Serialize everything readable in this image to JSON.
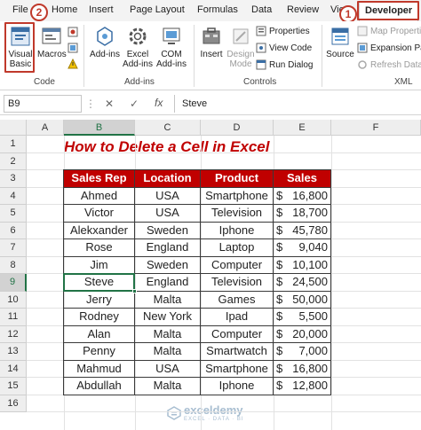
{
  "ribbon": {
    "tabs": [
      "File",
      "Home",
      "Insert",
      "Page Layout",
      "Formulas",
      "Data",
      "Review",
      "View",
      "Developer"
    ],
    "active_tab": "Developer",
    "groups": {
      "code": {
        "label": "Code",
        "visual_basic": "Visual Basic",
        "macros": "Macros"
      },
      "addins": {
        "label": "Add-ins",
        "add_ins": "Add-ins",
        "excel_add_ins": "Excel Add-ins",
        "com_add_ins": "COM Add-ins"
      },
      "controls": {
        "label": "Controls",
        "insert": "Insert",
        "design_mode": "Design Mode",
        "properties": "Properties",
        "view_code": "View Code",
        "run_dialog": "Run Dialog"
      },
      "xml": {
        "label": "XML",
        "source": "Source",
        "map_properties": "Map Properties",
        "expansion_packs": "Expansion Pac",
        "refresh_data": "Refresh Data"
      }
    },
    "badges": {
      "developer": "1",
      "visual_basic": "2"
    }
  },
  "formula_bar": {
    "name_box": "B9",
    "cancel_symbol": "✕",
    "enter_symbol": "✓",
    "fx_label": "fx",
    "value": "Steve"
  },
  "sheet": {
    "columns": [
      "A",
      "B",
      "C",
      "D",
      "E",
      "F"
    ],
    "selected_column": "B",
    "rows": [
      "1",
      "2",
      "3",
      "4",
      "5",
      "6",
      "7",
      "8",
      "9",
      "10",
      "11",
      "12",
      "13",
      "14",
      "15",
      "16"
    ],
    "selected_row": "9",
    "title": "How to Delete a Cell in Excel",
    "table": {
      "headers": [
        "Sales Rep",
        "Location",
        "Product",
        "Sales"
      ],
      "currency": "$",
      "rows": [
        [
          "Ahmed",
          "USA",
          "Smartphone",
          "16,800"
        ],
        [
          "Victor",
          "USA",
          "Television",
          "18,700"
        ],
        [
          "Alekxander",
          "Sweden",
          "Iphone",
          "45,780"
        ],
        [
          "Rose",
          "England",
          "Laptop",
          "9,040"
        ],
        [
          "Jim",
          "Sweden",
          "Computer",
          "10,100"
        ],
        [
          "Steve",
          "England",
          "Television",
          "24,500"
        ],
        [
          "Jerry",
          "Malta",
          "Games",
          "50,000"
        ],
        [
          "Rodney",
          "New York",
          "Ipad",
          "5,500"
        ],
        [
          "Alan",
          "Malta",
          "Computer",
          "20,000"
        ],
        [
          "Penny",
          "Malta",
          "Smartwatch",
          "7,000"
        ],
        [
          "Mahmud",
          "USA",
          "Smartphone",
          "16,800"
        ],
        [
          "Abdullah",
          "Malta",
          "Iphone",
          "12,800"
        ]
      ]
    }
  },
  "watermark": {
    "brand": "exceldemy",
    "tagline": "EXCEL · DATA · BI"
  },
  "colors": {
    "accent_red": "#c00000",
    "excel_green": "#217346",
    "badge_red": "#c0392b"
  }
}
